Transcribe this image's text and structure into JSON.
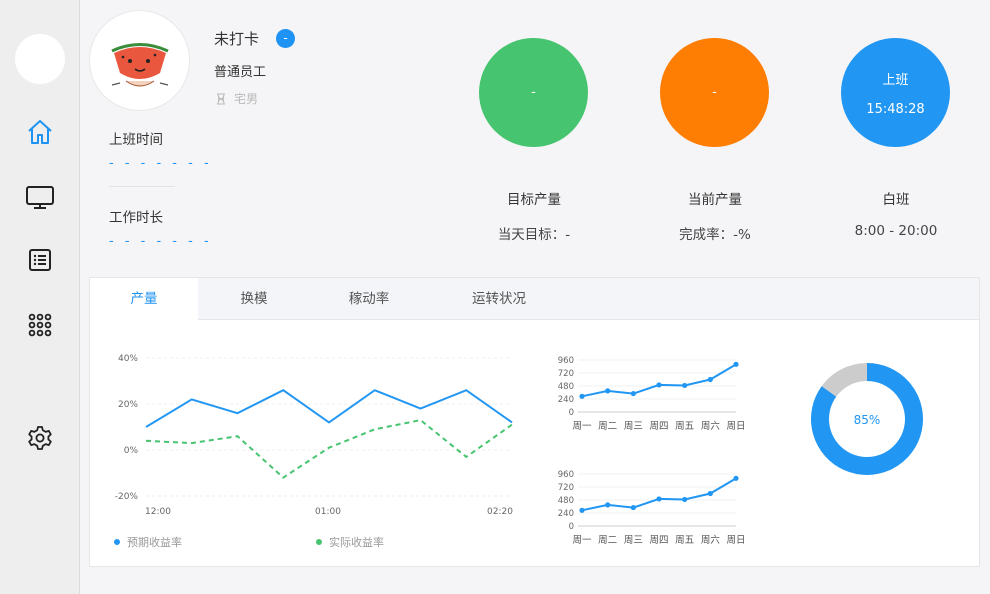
{
  "sidebar": {
    "items": [
      {
        "name": "home-icon"
      },
      {
        "name": "monitor-icon"
      },
      {
        "name": "list-icon"
      },
      {
        "name": "apps-grid-icon"
      },
      {
        "name": "gear-icon"
      }
    ],
    "active_color": "#1f93f3"
  },
  "profile": {
    "status": "未打卡",
    "badge": "-",
    "role": "普通员工",
    "tag": "宅男",
    "work_start_label": "上班时间",
    "work_start_value": "- - - - - - -",
    "work_duration_label": "工作时长",
    "work_duration_value": "- - - - - - -"
  },
  "stats": [
    {
      "circle_text": "-",
      "label": "目标产量",
      "sub": "当天目标：-",
      "color": "#47c46f"
    },
    {
      "circle_text": "-",
      "label": "当前产量",
      "sub": "完成率：-%",
      "color": "#fe7d03"
    },
    {
      "circle_text": "上班",
      "circle_time": "15:48:28",
      "label": "白班",
      "sub": "8:00 - 20:00",
      "color": "#2196f3"
    }
  ],
  "tabs": [
    {
      "label": "产量",
      "active": true
    },
    {
      "label": "换模",
      "active": false
    },
    {
      "label": "稼动率",
      "active": false
    },
    {
      "label": "运转状况",
      "active": false
    }
  ],
  "chart_data": [
    {
      "type": "line",
      "x": [
        "12:00",
        "",
        "",
        "",
        "",
        "",
        "",
        "",
        "",
        "",
        "",
        "",
        "",
        "",
        "",
        "02:20"
      ],
      "xticks": [
        "12:00",
        "01:00",
        "02:20"
      ],
      "yticks": [
        "40%",
        "20%",
        "0%",
        "-20%"
      ],
      "ylim": [
        -20,
        40
      ],
      "series": [
        {
          "name": "预期收益率",
          "color": "#2196f3",
          "dashed": false,
          "values": [
            10,
            22,
            16,
            26,
            12,
            26,
            18,
            26,
            12
          ]
        },
        {
          "name": "实际收益率",
          "color": "#47c46f",
          "dashed": true,
          "values": [
            4,
            3,
            6,
            -12,
            1,
            9,
            13,
            -3,
            11
          ]
        }
      ],
      "legend": "bottom-left",
      "grid": true
    },
    {
      "type": "line",
      "categories": [
        "周一",
        "周二",
        "周三",
        "周四",
        "周五",
        "周六",
        "周日"
      ],
      "yticks": [
        "960",
        "720",
        "480",
        "240",
        "0"
      ],
      "ylim": [
        0,
        960
      ],
      "values": [
        290,
        390,
        340,
        500,
        490,
        600,
        880
      ],
      "color": "#2196f3"
    },
    {
      "type": "line",
      "categories": [
        "周一",
        "周二",
        "周三",
        "周四",
        "周五",
        "周六",
        "周日"
      ],
      "yticks": [
        "960",
        "720",
        "480",
        "240",
        "0"
      ],
      "ylim": [
        0,
        960
      ],
      "values": [
        290,
        390,
        340,
        500,
        490,
        600,
        880
      ],
      "color": "#2196f3"
    },
    {
      "type": "pie",
      "label": "85%",
      "values": [
        85,
        15
      ],
      "colors": [
        "#2196f3",
        "#cccccc"
      ]
    }
  ]
}
